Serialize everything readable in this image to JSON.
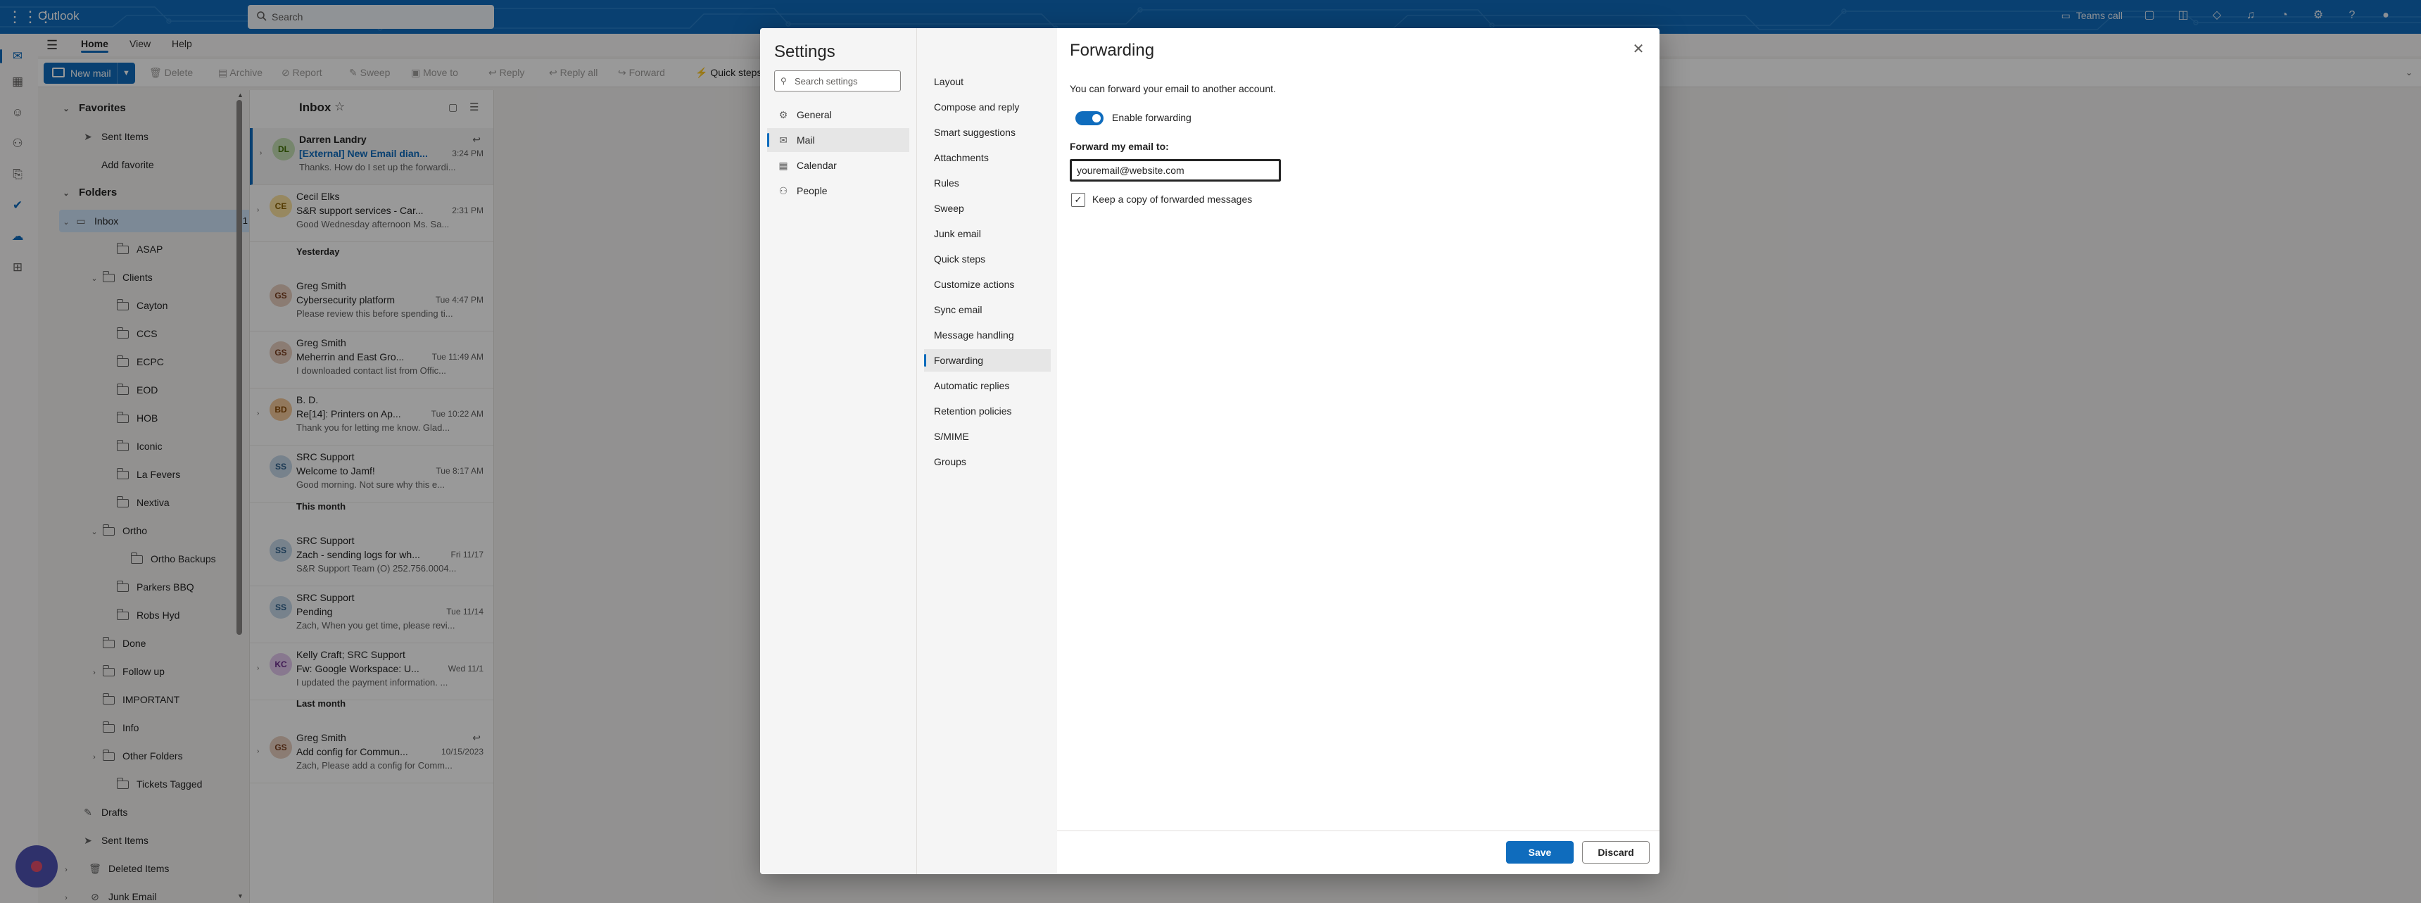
{
  "app": {
    "title": "Outlook"
  },
  "search": {
    "placeholder": "Search"
  },
  "topbar": {
    "teams_label": "Teams call"
  },
  "ribbon_tabs": [
    {
      "label": "Home",
      "active": true
    },
    {
      "label": "View",
      "active": false
    },
    {
      "label": "Help",
      "active": false
    }
  ],
  "ribbon": {
    "new_mail": "New mail",
    "delete": "Delete",
    "archive": "Archive",
    "report": "Report",
    "sweep": "Sweep",
    "move_to": "Move to",
    "reply": "Reply",
    "reply_all": "Reply all",
    "forward": "Forward",
    "quick_steps": "Quick steps"
  },
  "folders": {
    "favorites_label": "Favorites",
    "favorites": [
      {
        "label": "Sent Items"
      },
      {
        "label": "Add favorite"
      }
    ],
    "folders_label": "Folders",
    "inbox": {
      "label": "Inbox",
      "count": "1"
    },
    "items": [
      {
        "label": "ASAP"
      },
      {
        "label": "Clients"
      },
      {
        "label": "Cayton"
      },
      {
        "label": "CCS"
      },
      {
        "label": "ECPC"
      },
      {
        "label": "EOD"
      },
      {
        "label": "HOB"
      },
      {
        "label": "Iconic"
      },
      {
        "label": "La Fevers"
      },
      {
        "label": "Nextiva"
      },
      {
        "label": "Ortho"
      },
      {
        "label": "Ortho Backups"
      },
      {
        "label": "Parkers BBQ"
      },
      {
        "label": "Robs Hyd"
      },
      {
        "label": "Done"
      },
      {
        "label": "Follow up"
      },
      {
        "label": "IMPORTANT"
      },
      {
        "label": "Info"
      },
      {
        "label": "Other Folders"
      },
      {
        "label": "Tickets Tagged"
      },
      {
        "label": "Drafts"
      },
      {
        "label": "Sent Items"
      },
      {
        "label": "Deleted Items"
      },
      {
        "label": "Junk Email"
      }
    ]
  },
  "message_list": {
    "title": "Inbox",
    "groups": {
      "yesterday": "Yesterday",
      "this_month": "This month",
      "last_month": "Last month"
    },
    "messages": [
      {
        "initials": "DL",
        "from": "Darren Landry",
        "subject": "[External] New Email dian...",
        "preview": "Thanks. How do I set up the forwardi...",
        "time": "3:24 PM",
        "avatar_color": "#c5e0b4",
        "avatar_text": "#437406"
      },
      {
        "initials": "CE",
        "from": "Cecil Elks",
        "subject": "S&R support services - Car...",
        "preview": "Good Wednesday afternoon Ms. Sa...",
        "time": "2:31 PM",
        "avatar_color": "#fce3a0",
        "avatar_text": "#8a6100"
      },
      {
        "initials": "GS",
        "from": "Greg Smith",
        "subject": "Cybersecurity platform",
        "preview": "Please review this before spending ti...",
        "time": "Tue 4:47 PM",
        "avatar_color": "#e8cfc0",
        "avatar_text": "#7a3f1f"
      },
      {
        "initials": "GS",
        "from": "Greg Smith",
        "subject": "Meherrin and East Gro...",
        "preview": "I downloaded contact list from Offic...",
        "time": "Tue 11:49 AM",
        "avatar_color": "#e8cfc0",
        "avatar_text": "#7a3f1f"
      },
      {
        "initials": "BD",
        "from": "B. D.",
        "subject": "Re[14]: Printers on Ap...",
        "preview": "Thank you for letting me know. Glad...",
        "time": "Tue 10:22 AM",
        "avatar_color": "#f4c89a",
        "avatar_text": "#8a4b08"
      },
      {
        "initials": "SS",
        "from": "SRC Support",
        "subject": "Welcome to Jamf!",
        "preview": "Good morning. Not sure why this e...",
        "time": "Tue 8:17 AM",
        "avatar_color": "#c7d9ea",
        "avatar_text": "#2d5f8b"
      },
      {
        "initials": "SS",
        "from": "SRC Support",
        "subject": "Zach - sending logs for wh...",
        "preview": "S&R Support Team (O) 252.756.0004...",
        "time": "Fri 11/17",
        "avatar_color": "#c7d9ea",
        "avatar_text": "#2d5f8b"
      },
      {
        "initials": "SS",
        "from": "SRC Support",
        "subject": "Pending",
        "preview": "Zach, When you get time, please revi...",
        "time": "Tue 11/14",
        "avatar_color": "#c7d9ea",
        "avatar_text": "#2d5f8b"
      },
      {
        "initials": "KC",
        "from": "Kelly Craft; SRC Support",
        "subject": "Fw: Google Workspace: U...",
        "preview": "I updated the payment information. ...",
        "time": "Wed 11/1",
        "avatar_color": "#e3c8ef",
        "avatar_text": "#6b2c8b"
      },
      {
        "initials": "GS",
        "from": "Greg Smith",
        "subject": "Add config for Commun...",
        "preview": "Zach, Please add a config for Comm...",
        "time": "10/15/2023",
        "avatar_color": "#e8cfc0",
        "avatar_text": "#7a3f1f"
      }
    ]
  },
  "settings": {
    "title": "Settings",
    "search_placeholder": "Search settings",
    "categories": [
      {
        "label": "General",
        "icon": "gear-icon"
      },
      {
        "label": "Mail",
        "icon": "mail-icon"
      },
      {
        "label": "Calendar",
        "icon": "calendar-icon"
      },
      {
        "label": "People",
        "icon": "people-icon"
      }
    ],
    "subcategories": [
      "Layout",
      "Compose and reply",
      "Smart suggestions",
      "Attachments",
      "Rules",
      "Sweep",
      "Junk email",
      "Quick steps",
      "Customize actions",
      "Sync email",
      "Message handling",
      "Forwarding",
      "Automatic replies",
      "Retention policies",
      "S/MIME",
      "Groups"
    ],
    "forwarding": {
      "title": "Forwarding",
      "description": "You can forward your email to another account.",
      "enable_label": "Enable forwarding",
      "enabled": true,
      "forward_to_label": "Forward my email to:",
      "forward_to_value": "youremail@website.com",
      "keep_copy_label": "Keep a copy of forwarded messages",
      "keep_copy": true
    },
    "save_label": "Save",
    "discard_label": "Discard"
  },
  "colors": {
    "accent": "#0f6cbd",
    "selected_folder": "#cfe4fa",
    "overlay": "rgba(0,0,0,0.40)"
  }
}
